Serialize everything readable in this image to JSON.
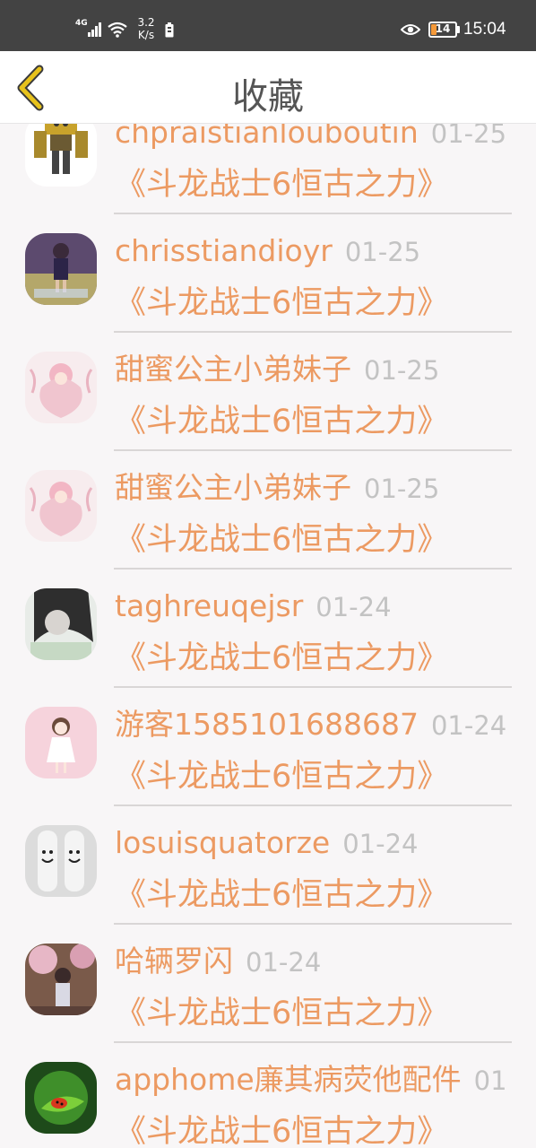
{
  "status_bar": {
    "network": "4G",
    "speed_value": "3.2",
    "speed_unit": "K/s",
    "battery_level": "14",
    "time": "15:04"
  },
  "header": {
    "title": "收藏",
    "back_icon": "chevron-left-icon"
  },
  "colors": {
    "accent": "#ec9a62",
    "date": "#c3c3c3",
    "status_bar_bg": "#434343",
    "back_icon": "#e7c21c"
  },
  "favorites": [
    {
      "user": "chpraistianlouboutin",
      "date": "01-25",
      "title": "《斗龙战士6恒古之力》",
      "avatar": "robot-avatar"
    },
    {
      "user": "chrisstiandioyr",
      "date": "01-25",
      "title": "《斗龙战士6恒古之力》",
      "avatar": "girl-photo-avatar"
    },
    {
      "user": "甜蜜公主小弟妹子",
      "date": "01-25",
      "title": "《斗龙战士6恒古之力》",
      "avatar": "anime-girl-avatar"
    },
    {
      "user": "甜蜜公主小弟妹子",
      "date": "01-25",
      "title": "《斗龙战士6恒古之力》",
      "avatar": "anime-girl-avatar"
    },
    {
      "user": "taghreuqejsr",
      "date": "01-24",
      "title": "《斗龙战士6恒古之力》",
      "avatar": "bw-girl-avatar"
    },
    {
      "user": "游客1585101688687",
      "date": "01-24",
      "title": "《斗龙战士6恒古之力》",
      "avatar": "cartoon-girl-avatar"
    },
    {
      "user": "losuisquatorze",
      "date": "01-24",
      "title": "《斗龙战士6恒古之力》",
      "avatar": "smiley-fingers-avatar"
    },
    {
      "user": "哈辆罗闪",
      "date": "01-24",
      "title": "《斗龙战士6恒古之力》",
      "avatar": "blossom-girl-avatar"
    },
    {
      "user": "apphome廉其病荧他配件",
      "date": "01",
      "title": "《斗龙战士6恒古之力》",
      "avatar": "ladybug-leaf-avatar"
    }
  ]
}
